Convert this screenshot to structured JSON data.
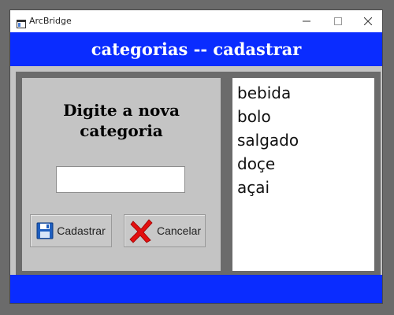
{
  "window": {
    "title": "ArcBridge"
  },
  "header": {
    "title": "categorias -- cadastrar"
  },
  "form": {
    "prompt": "Digite a nova categoria",
    "input_value": "",
    "save_label": "Cadastrar",
    "cancel_label": "Cancelar"
  },
  "categories": [
    "bebida",
    "bolo",
    "salgado",
    "doçe",
    "açai"
  ],
  "colors": {
    "accent": "#0a2cff",
    "frame": "#6b6b6b",
    "panel": "#c4c4c4"
  },
  "icons": {
    "save": "floppy-disk-icon",
    "cancel": "red-x-icon"
  }
}
